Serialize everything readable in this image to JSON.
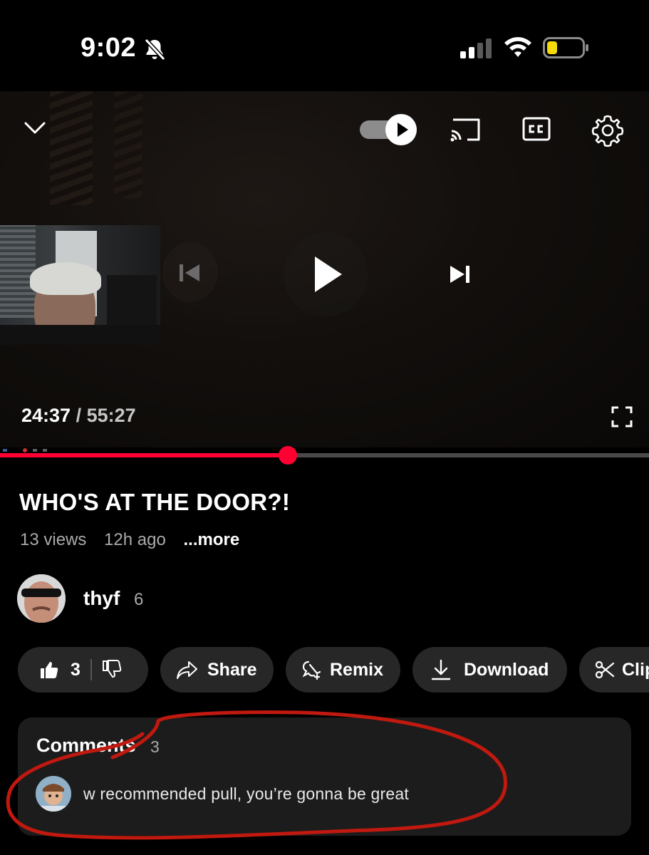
{
  "status_bar": {
    "time": "9:02",
    "icons": [
      "bell-slash-icon",
      "cellular-signal-icon",
      "wifi-icon",
      "battery-low-icon"
    ],
    "battery_color": "#f5d90a"
  },
  "player": {
    "current_time": "24:37",
    "separator": " / ",
    "duration": "55:27",
    "progress_fraction": 0.444,
    "autoplay_on": true,
    "accent_color": "#ff0033",
    "icons": [
      "chevron-down-icon",
      "autoplay-toggle",
      "cast-icon",
      "closed-captions-icon",
      "gear-icon",
      "skip-previous-icon",
      "play-icon",
      "skip-next-icon",
      "fullscreen-icon"
    ]
  },
  "video": {
    "title": "WHO'S AT THE DOOR?!",
    "views": "13 views",
    "age": "12h ago",
    "more_label": "...more"
  },
  "channel": {
    "name": "thyf",
    "subscriber_count": "6"
  },
  "actions": {
    "like_count": "3",
    "share_label": "Share",
    "remix_label": "Remix",
    "download_label": "Download",
    "clip_label": "Clip"
  },
  "comments": {
    "header": "Comments",
    "count": "3",
    "top_comment": "w recommended pull, you’re gonna be great"
  },
  "annotation_color": "#c0190f"
}
